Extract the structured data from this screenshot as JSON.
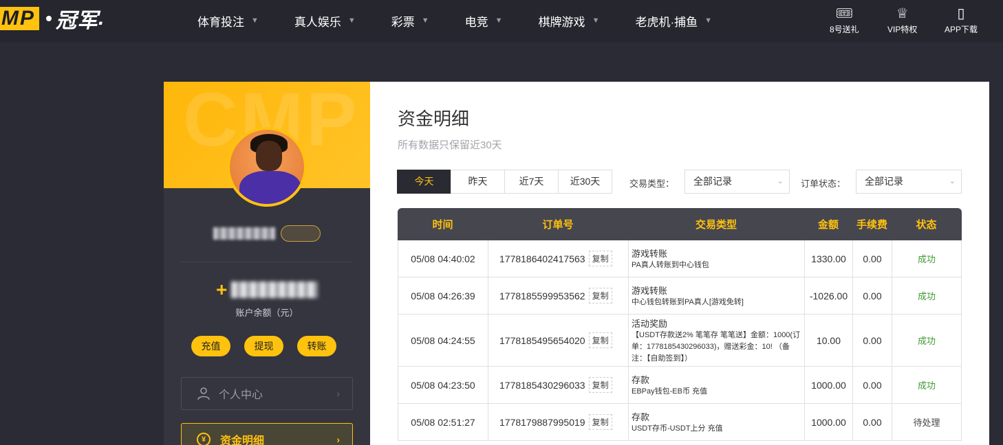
{
  "header": {
    "logo_mp": "MP",
    "logo_cn": "冠军",
    "nav": [
      {
        "label": "体育投注"
      },
      {
        "label": "真人娱乐"
      },
      {
        "label": "彩票"
      },
      {
        "label": "电竞"
      },
      {
        "label": "棋牌游戏"
      },
      {
        "label": "老虎机·捕鱼"
      }
    ],
    "quick": [
      {
        "label": "8号送礼",
        "icon": "gift-ticket-icon"
      },
      {
        "label": "VIP特权",
        "icon": "crown-icon"
      },
      {
        "label": "APP下载",
        "icon": "phone-icon"
      }
    ]
  },
  "sidebar": {
    "watermark": "CMP",
    "balance_prefix": "+",
    "balance_label": "账户余额（元）",
    "actions": [
      "充值",
      "提现",
      "转账"
    ],
    "menu": [
      {
        "label": "个人中心",
        "icon": "user-icon"
      },
      {
        "label": "资金明细",
        "icon": "yen-icon",
        "active": true
      }
    ]
  },
  "main": {
    "title": "资金明细",
    "subtitle": "所有数据只保留近30天",
    "tabs": [
      "今天",
      "昨天",
      "近7天",
      "近30天"
    ],
    "active_tab": "今天",
    "filters": {
      "type_label": "交易类型：",
      "type_value": "全部记录",
      "status_label": "订单状态：",
      "status_value": "全部记录"
    },
    "table": {
      "headers": [
        "时间",
        "订单号",
        "交易类型",
        "金额",
        "手续费",
        "状态"
      ],
      "copy_label": "复制",
      "rows": [
        {
          "time": "05/08 04:40:02",
          "order": "1778186402417563",
          "type": "游戏转账",
          "desc": "PA真人转账到中心钱包",
          "amount": "1330.00",
          "fee": "0.00",
          "status": "成功",
          "status_kind": "ok"
        },
        {
          "time": "05/08 04:26:39",
          "order": "1778185599953562",
          "type": "游戏转账",
          "desc": "中心钱包转账到PA真人[游戏免转]",
          "amount": "-1026.00",
          "fee": "0.00",
          "status": "成功",
          "status_kind": "ok"
        },
        {
          "time": "05/08 04:24:55",
          "order": "1778185495654020",
          "type": "活动奖励",
          "desc": "【USDT存款送2% 笔笔存 笔笔送】金额：1000(订单：1778185430296033)，赠送彩金：10! （备注：【自助签到】）",
          "amount": "10.00",
          "fee": "0.00",
          "status": "成功",
          "status_kind": "ok"
        },
        {
          "time": "05/08 04:23:50",
          "order": "1778185430296033",
          "type": "存款",
          "desc": "EBPay钱包-EB币 充值",
          "amount": "1000.00",
          "fee": "0.00",
          "status": "成功",
          "status_kind": "ok"
        },
        {
          "time": "05/08 02:51:27",
          "order": "1778179887995019",
          "type": "存款",
          "desc": "USDT存币-USDT上分 充值",
          "amount": "1000.00",
          "fee": "0.00",
          "status": "待处理",
          "status_kind": "pending"
        }
      ]
    }
  }
}
